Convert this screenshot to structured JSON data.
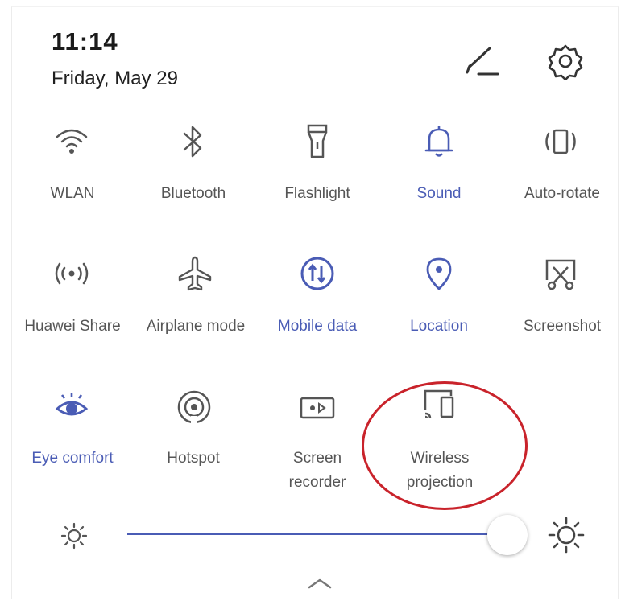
{
  "status": {
    "time": "11:14",
    "date": "Friday, May 29"
  },
  "header_icons": {
    "edit": "edit-icon",
    "settings": "gear-icon"
  },
  "tiles": [
    {
      "label": "WLAN",
      "icon": "wifi-icon",
      "active": false
    },
    {
      "label": "Bluetooth",
      "icon": "bluetooth-icon",
      "active": false
    },
    {
      "label": "Flashlight",
      "icon": "flashlight-icon",
      "active": false
    },
    {
      "label": "Sound",
      "icon": "bell-icon",
      "active": true
    },
    {
      "label": "Auto-rotate",
      "icon": "auto-rotate-icon",
      "active": false
    },
    {
      "label": "Huawei Share",
      "icon": "huawei-share-icon",
      "active": false
    },
    {
      "label": "Airplane mode",
      "icon": "airplane-icon",
      "active": false
    },
    {
      "label": "Mobile data",
      "icon": "mobile-data-icon",
      "active": true
    },
    {
      "label": "Location",
      "icon": "location-pin-icon",
      "active": true
    },
    {
      "label": "Screenshot",
      "icon": "screenshot-icon",
      "active": false
    },
    {
      "label": "Eye comfort",
      "icon": "eye-icon",
      "active": true
    },
    {
      "label": "Hotspot",
      "icon": "hotspot-icon",
      "active": false
    },
    {
      "label_line1": "Screen",
      "label_line2": "recorder",
      "icon": "screen-recorder-icon",
      "active": false
    },
    {
      "label_line1": "Wireless",
      "label_line2": "projection",
      "icon": "wireless-projection-icon",
      "active": false
    }
  ],
  "brightness": {
    "level": 1.0,
    "min_icon": "brightness-low-icon",
    "max_icon": "brightness-high-icon"
  },
  "colors": {
    "accent": "#4a5cb5",
    "inactive": "#555555",
    "annotation": "#c9232b"
  },
  "footer": {
    "expand_icon": "chevron-up-icon"
  }
}
